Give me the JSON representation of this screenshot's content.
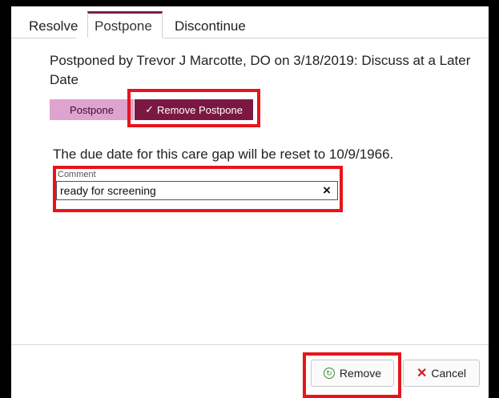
{
  "tabs": {
    "resolve": "Resolve",
    "postpone": "Postpone",
    "discontinue": "Discontinue"
  },
  "postpone_info": "Postponed by Trevor J Marcotte, DO on 3/18/2019: Discuss at a Later Date",
  "segmented": {
    "postpone_label": "Postpone",
    "remove_postpone_label": "Remove Postpone",
    "check_symbol": "✓"
  },
  "due_date_text": "The due date for this care gap will be reset to 10/9/1966.",
  "comment": {
    "label": "Comment",
    "value": "ready for screening",
    "clear_symbol": "×"
  },
  "footer": {
    "remove_label": "Remove",
    "cancel_label": "Cancel",
    "cancel_symbol": "✕"
  },
  "colors": {
    "accent": "#7a1842",
    "postpone_pink": "#dfa3cf",
    "highlight": "#e8141b",
    "cancel_red": "#d02020",
    "remove_green": "#3a8a3a"
  },
  "icons": [
    "check-icon",
    "clear-icon",
    "remove-icon",
    "cancel-icon"
  ]
}
